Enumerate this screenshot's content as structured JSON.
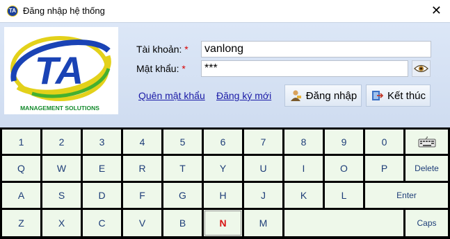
{
  "window": {
    "title": "Đăng nhập hệ thống",
    "close_glyph": "✕",
    "icon": "ta-app-icon",
    "icon_text": "TA"
  },
  "logo": {
    "letters": "TA",
    "tagline": "MANAGEMENT SOLUTIONS"
  },
  "form": {
    "account_label": "Tài khoản:",
    "password_label": "Mật khẩu:",
    "required_mark": "*",
    "account_value": "vanlong",
    "password_value": "***",
    "show_password_icon": "eye-icon"
  },
  "links": {
    "forgot": "Quên mật khẩu",
    "register": "Đăng ký mới"
  },
  "buttons": {
    "login": "Đăng nhập",
    "exit": "Kết thúc",
    "login_icon": "user-login-icon",
    "exit_icon": "exit-door-icon"
  },
  "keyboard": {
    "row1": [
      "1",
      "2",
      "3",
      "4",
      "5",
      "6",
      "7",
      "8",
      "9",
      "0"
    ],
    "row2": [
      "Q",
      "W",
      "E",
      "R",
      "T",
      "Y",
      "U",
      "I",
      "O",
      "P"
    ],
    "row3": [
      "A",
      "S",
      "D",
      "F",
      "G",
      "H",
      "J",
      "K",
      "L"
    ],
    "row4": [
      "Z",
      "X",
      "C",
      "V",
      "B",
      "N",
      "M"
    ],
    "keyboard_icon": "keyboard-icon",
    "delete": "Delete",
    "enter": "Enter",
    "caps": "Caps",
    "active_key": "N",
    "colors": {
      "key_bg": "#eef8ea",
      "key_text": "#1d3d78",
      "active_text": "#d81414",
      "grid": "#000000"
    }
  }
}
